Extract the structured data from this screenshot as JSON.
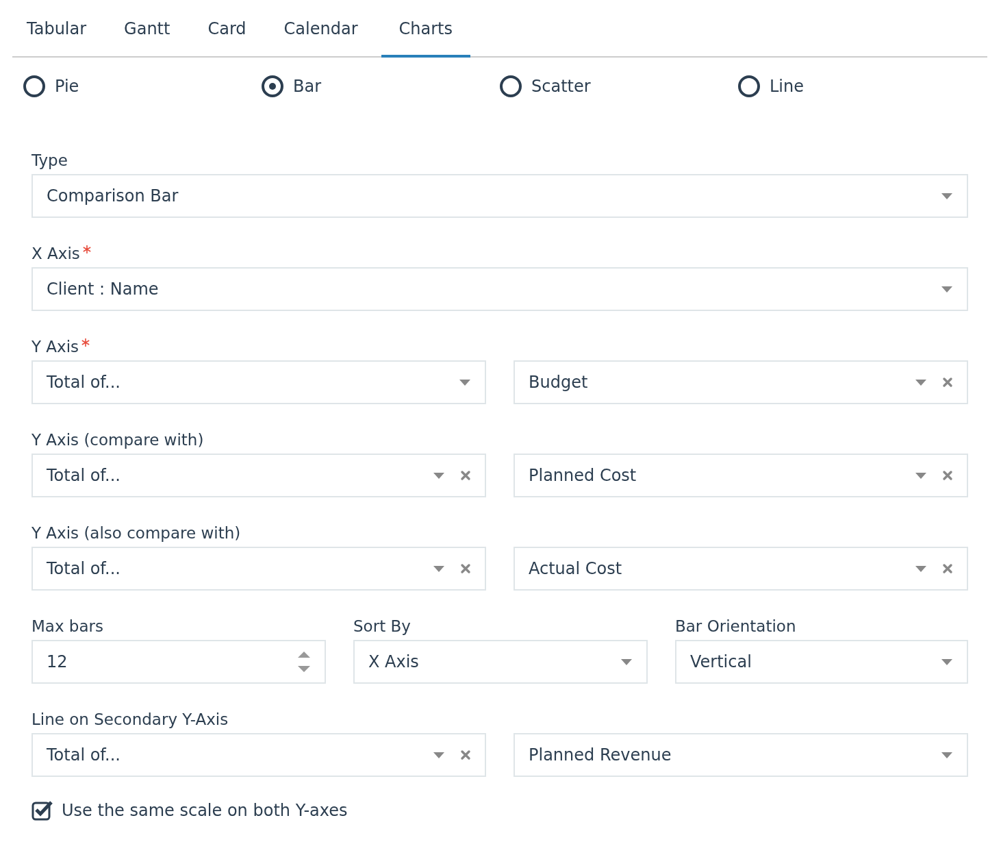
{
  "tabs": [
    {
      "label": "Tabular",
      "selected": false
    },
    {
      "label": "Gantt",
      "selected": false
    },
    {
      "label": "Card",
      "selected": false
    },
    {
      "label": "Calendar",
      "selected": false
    },
    {
      "label": "Charts",
      "selected": true
    }
  ],
  "chart_types": [
    {
      "label": "Pie",
      "selected": false
    },
    {
      "label": "Bar",
      "selected": true
    },
    {
      "label": "Scatter",
      "selected": false
    },
    {
      "label": "Line",
      "selected": false
    }
  ],
  "rows": [
    {
      "fields": [
        {
          "label": "Type",
          "required": false,
          "controls": [
            {
              "kind": "select",
              "value": "Comparison Bar",
              "clearable": false
            }
          ]
        }
      ]
    },
    {
      "fields": [
        {
          "label": "X Axis",
          "required": true,
          "controls": [
            {
              "kind": "select",
              "value": "Client : Name",
              "clearable": false
            }
          ]
        }
      ]
    },
    {
      "fields": [
        {
          "label": "Y Axis",
          "required": true,
          "controls": [
            {
              "kind": "select",
              "value": "Total of...",
              "clearable": false
            },
            {
              "kind": "select",
              "value": "Budget",
              "clearable": true
            }
          ]
        }
      ]
    },
    {
      "fields": [
        {
          "label": "Y Axis (compare with)",
          "required": false,
          "controls": [
            {
              "kind": "select",
              "value": "Total of...",
              "clearable": true
            },
            {
              "kind": "select",
              "value": "Planned Cost",
              "clearable": true
            }
          ]
        }
      ]
    },
    {
      "fields": [
        {
          "label": "Y Axis (also compare with)",
          "required": false,
          "controls": [
            {
              "kind": "select",
              "value": "Total of...",
              "clearable": true
            },
            {
              "kind": "select",
              "value": "Actual Cost",
              "clearable": true
            }
          ]
        }
      ]
    },
    {
      "fields": [
        {
          "label": "Max bars",
          "required": false,
          "controls": [
            {
              "kind": "number",
              "value": "12"
            }
          ]
        },
        {
          "label": "Sort By",
          "required": false,
          "controls": [
            {
              "kind": "select",
              "value": "X Axis",
              "clearable": false
            }
          ]
        },
        {
          "label": "Bar Orientation",
          "required": false,
          "controls": [
            {
              "kind": "select",
              "value": "Vertical",
              "clearable": false
            }
          ]
        }
      ]
    },
    {
      "fields": [
        {
          "label": "Line on Secondary Y-Axis",
          "required": false,
          "controls": [
            {
              "kind": "select",
              "value": "Total of...",
              "clearable": true
            },
            {
              "kind": "select",
              "value": "Planned Revenue",
              "clearable": false
            }
          ]
        }
      ]
    }
  ],
  "same_scale": {
    "label": "Use the same scale on both Y-axes",
    "checked": true
  }
}
